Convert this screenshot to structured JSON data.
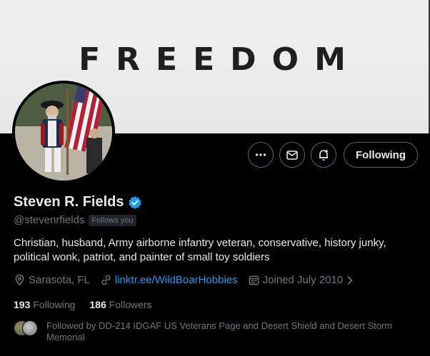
{
  "banner": {
    "text": "FREEDOM"
  },
  "profile": {
    "display_name": "Steven R. Fields",
    "handle": "@stevenrfields",
    "follows_you": "Follows you",
    "bio": "Christian, husband, Army airborne infantry veteran, conservative, history junky, political wonk, patriot, and painter of small toy soldiers",
    "location": "Sarasota, FL",
    "link": "linktr.ee/WildBoarHobbies",
    "joined": "Joined July 2010"
  },
  "actions": {
    "following_label": "Following"
  },
  "stats": {
    "following_count": "193",
    "following_label": "Following",
    "followers_count": "186",
    "followers_label": "Followers"
  },
  "followed_by": {
    "text": "Followed by DD-214 IDGAF US Veterans Page and Desert Shield and Desert Storm Memorial"
  },
  "colors": {
    "accent": "#1d9bf0",
    "verified": "#1d9bf0",
    "muted": "#71767b"
  }
}
